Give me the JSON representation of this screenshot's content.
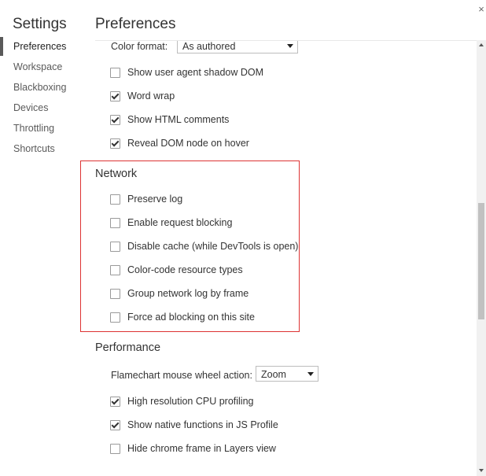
{
  "sidebar": {
    "title": "Settings",
    "items": [
      {
        "label": "Preferences",
        "selected": true
      },
      {
        "label": "Workspace",
        "selected": false
      },
      {
        "label": "Blackboxing",
        "selected": false
      },
      {
        "label": "Devices",
        "selected": false
      },
      {
        "label": "Throttling",
        "selected": false
      },
      {
        "label": "Shortcuts",
        "selected": false
      }
    ]
  },
  "header": {
    "title": "Preferences",
    "close_icon": "×"
  },
  "elements": {
    "color_format_label": "Color format:",
    "color_format_value": "As authored",
    "options": [
      {
        "label": "Show user agent shadow DOM",
        "checked": false
      },
      {
        "label": "Word wrap",
        "checked": true
      },
      {
        "label": "Show HTML comments",
        "checked": true
      },
      {
        "label": "Reveal DOM node on hover",
        "checked": true
      }
    ]
  },
  "network": {
    "title": "Network",
    "options": [
      {
        "label": "Preserve log",
        "checked": false
      },
      {
        "label": "Enable request blocking",
        "checked": false
      },
      {
        "label": "Disable cache (while DevTools is open)",
        "checked": false
      },
      {
        "label": "Color-code resource types",
        "checked": false
      },
      {
        "label": "Group network log by frame",
        "checked": false
      },
      {
        "label": "Force ad blocking on this site",
        "checked": false
      }
    ]
  },
  "performance": {
    "title": "Performance",
    "flamechart_label": "Flamechart mouse wheel action:",
    "flamechart_value": "Zoom",
    "options": [
      {
        "label": "High resolution CPU profiling",
        "checked": true
      },
      {
        "label": "Show native functions in JS Profile",
        "checked": true
      },
      {
        "label": "Hide chrome frame in Layers view",
        "checked": false
      }
    ]
  },
  "colors": {
    "highlight_border": "#dd3333"
  }
}
